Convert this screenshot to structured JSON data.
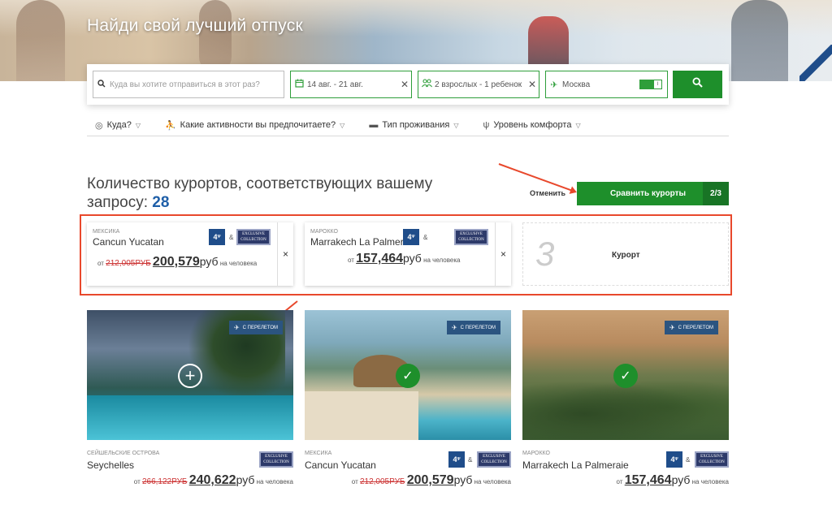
{
  "hero": {
    "title": "Найди свой лучший отпуск"
  },
  "search": {
    "destination_placeholder": "Куда вы хотите отправиться в этот раз?",
    "dates": "14 авг. - 21 авг.",
    "guests": "2 взрослых - 1 ребенок",
    "departure_city": "Москва",
    "toggle_label": "I"
  },
  "filters": [
    {
      "label": "Куда?",
      "icon": "globe-icon"
    },
    {
      "label": "Какие активности вы предпочитаете?",
      "icon": "activity-icon"
    },
    {
      "label": "Тип проживания",
      "icon": "bed-icon"
    },
    {
      "label": "Уровень комфорта",
      "icon": "trident-icon"
    }
  ],
  "results": {
    "title": "Количество курортов, соответствующих вашему запросу:",
    "count": "28",
    "cancel_label": "Отменить",
    "compare_label": "Сравнить курорты",
    "compare_count": "2/3"
  },
  "compare_slots": [
    {
      "country": "Мексика",
      "name": "Cancun Yucatan",
      "from": "от",
      "old_price": "212,005РУБ",
      "price": "200,579",
      "currency": "руб",
      "per": "на человека",
      "trident": "4",
      "amp": "&",
      "collection": "EXCLUSIVE COLLECTION",
      "remove": "×"
    },
    {
      "country": "Марокко",
      "name": "Marrakech La Palmeraie",
      "from": "от",
      "price": "157,464",
      "currency": "руб",
      "per": "на человека",
      "trident": "4",
      "amp": "&",
      "collection": "EXCLUSIVE COLLECTION",
      "remove": "×"
    },
    {
      "number": "3",
      "label": "Курорт"
    }
  ],
  "resorts": [
    {
      "country": "Сейшельские острова",
      "name": "Seychelles",
      "from": "от",
      "old_price": "266,122РУБ",
      "price": "240,622",
      "currency": "руб",
      "per": "на человека",
      "flight_tag": "С перелетом",
      "collection": "EXCLUSIVE COLLECTION",
      "selected": false
    },
    {
      "country": "Мексика",
      "name": "Cancun Yucatan",
      "from": "от",
      "old_price": "212,005РУБ",
      "price": "200,579",
      "currency": "руб",
      "per": "на человека",
      "flight_tag": "С перелетом",
      "trident": "4",
      "amp": "&",
      "collection": "EXCLUSIVE COLLECTION",
      "selected": true
    },
    {
      "country": "Марокко",
      "name": "Marrakech La Palmeraie",
      "from": "от",
      "price": "157,464",
      "currency": "руб",
      "per": "на человека",
      "flight_tag": "С перелетом",
      "trident": "4",
      "amp": "&",
      "collection": "EXCLUSIVE COLLECTION",
      "selected": true
    }
  ],
  "colors": {
    "brand_green": "#1e8f2b",
    "brand_blue": "#1f5fa8",
    "annotation_red": "#e8482c"
  }
}
